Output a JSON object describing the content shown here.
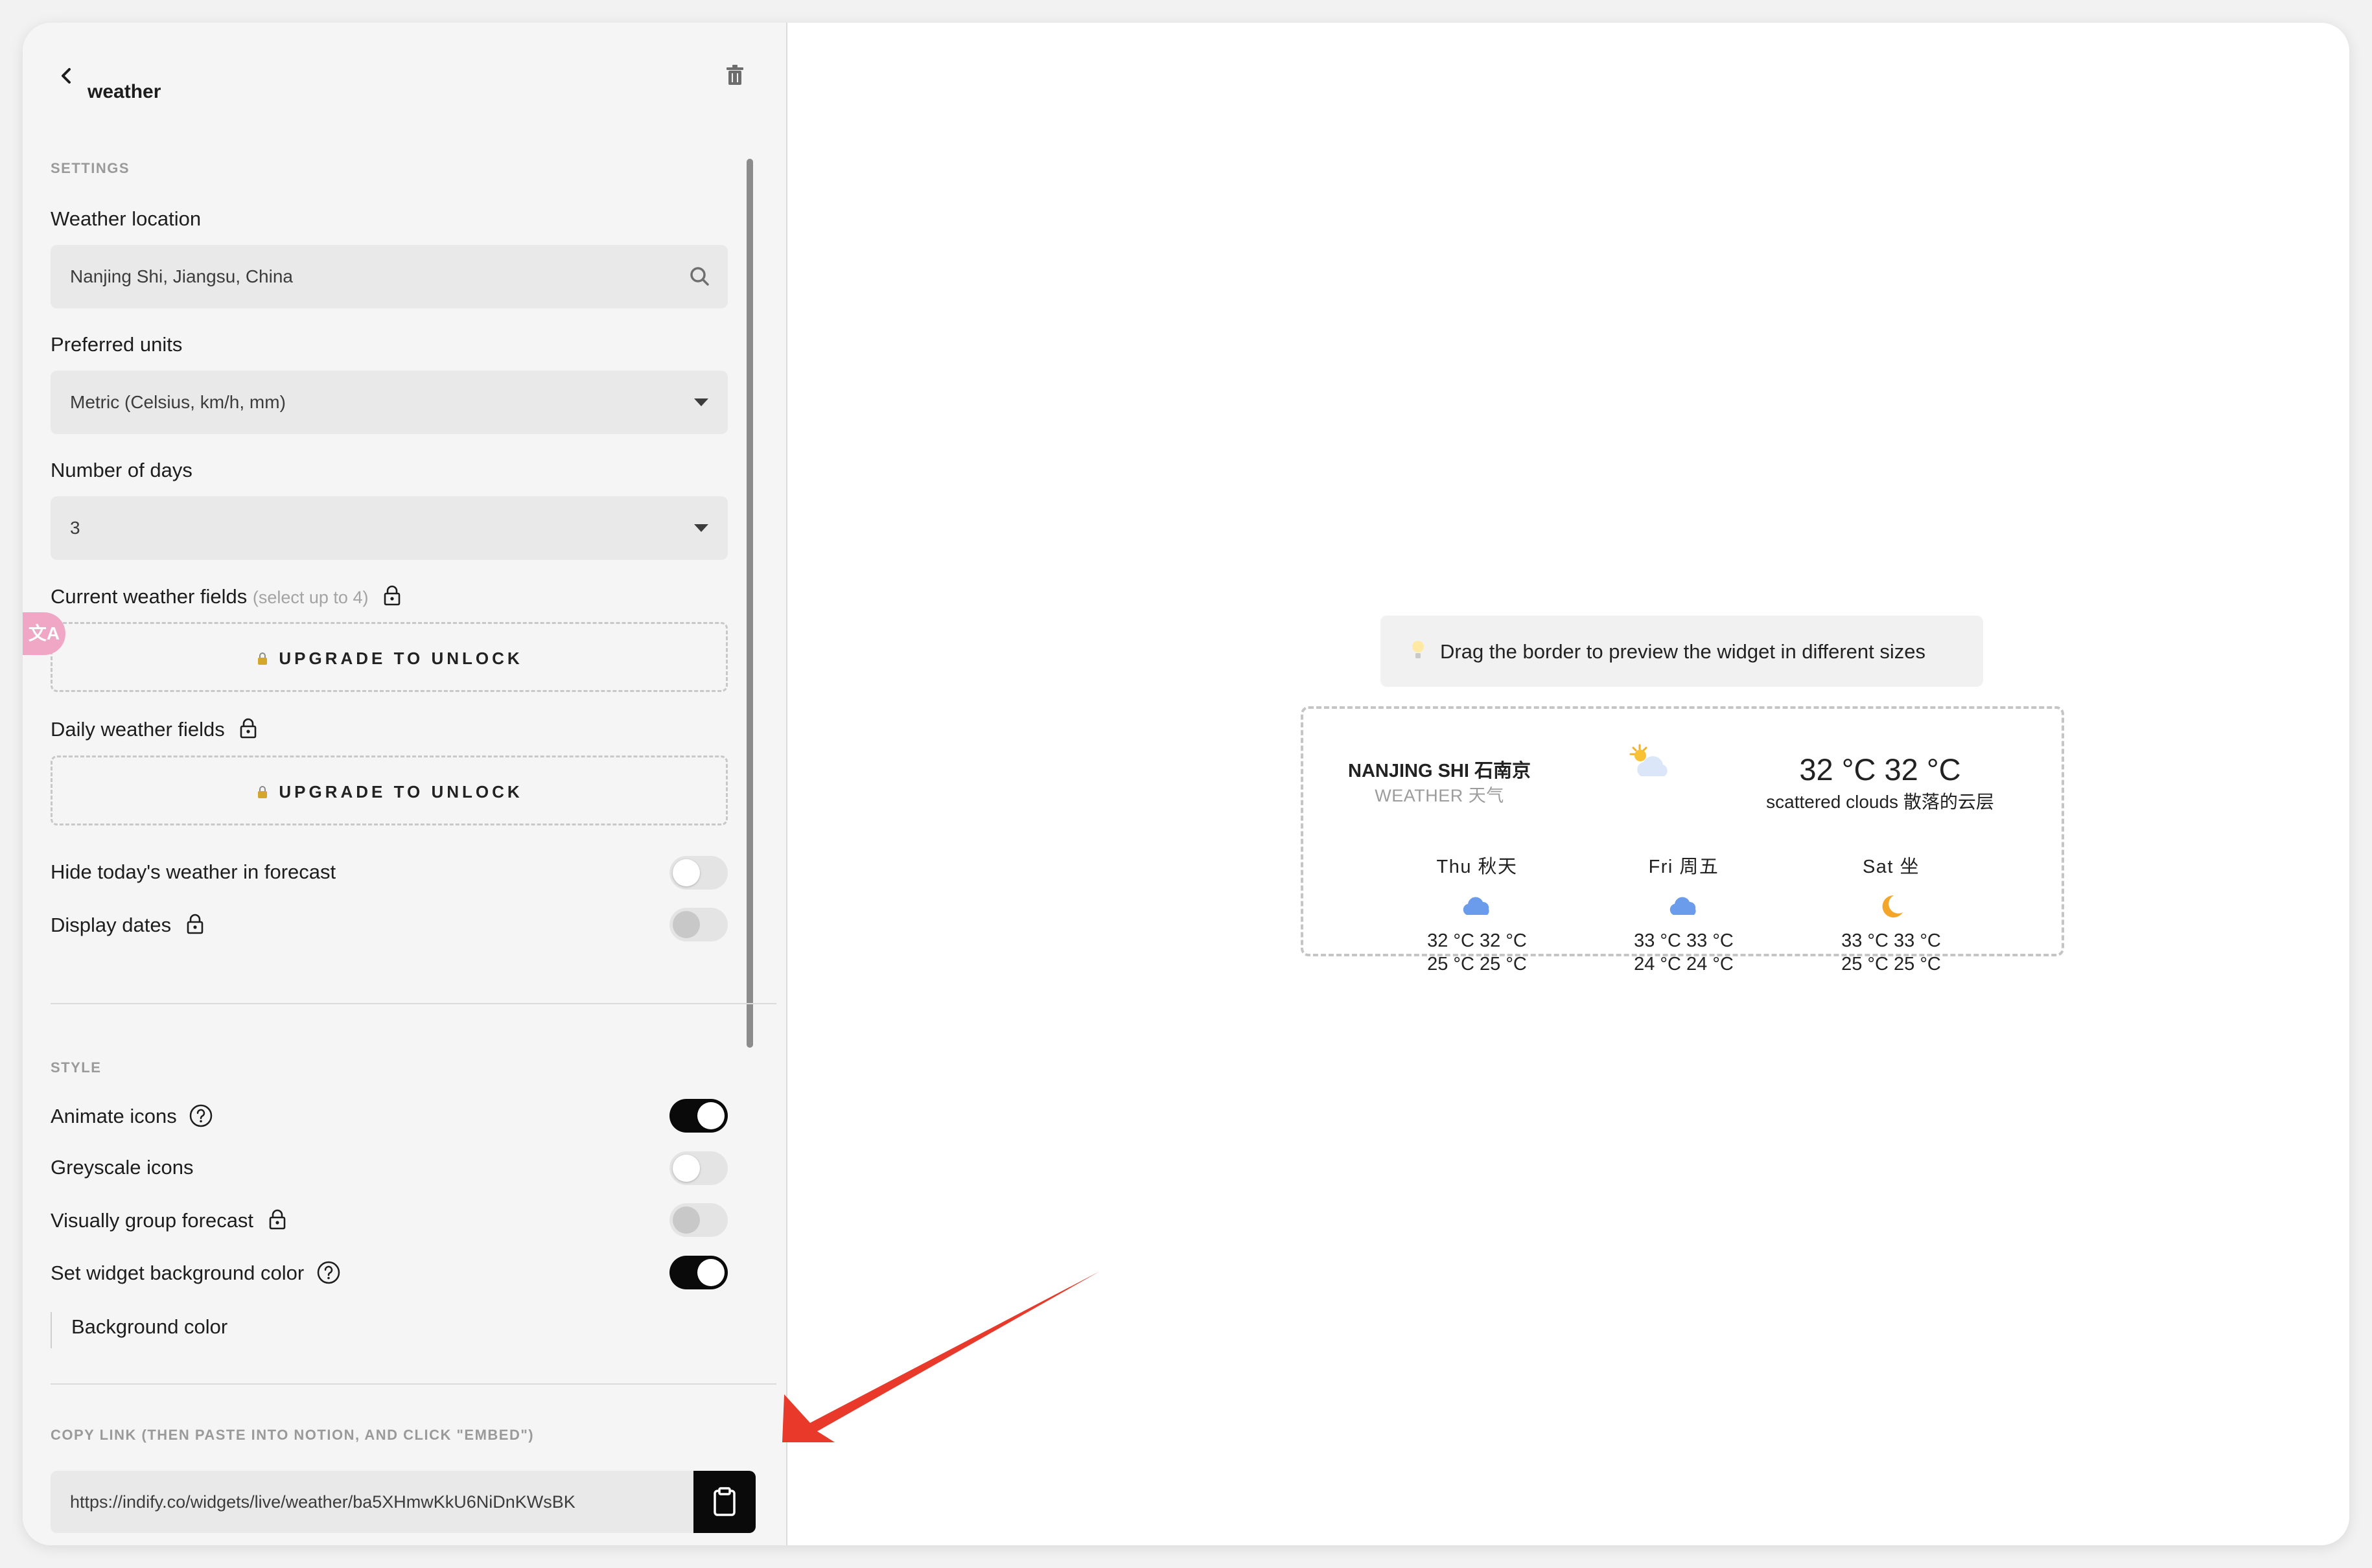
{
  "header": {
    "title": "weather"
  },
  "settings": {
    "section_label": "SETTINGS",
    "location": {
      "label": "Weather location",
      "value": "Nanjing Shi, Jiangsu, China"
    },
    "units": {
      "label": "Preferred units",
      "value": "Metric (Celsius, km/h, mm)"
    },
    "days": {
      "label": "Number of days",
      "value": "3"
    },
    "current_fields": {
      "label": "Current weather fields",
      "hint": "(select up to 4)",
      "button": "UPGRADE TO UNLOCK"
    },
    "daily_fields": {
      "label": "Daily weather fields",
      "button": "UPGRADE TO UNLOCK"
    },
    "hide_today": {
      "label": "Hide today's weather in forecast",
      "state": "off"
    },
    "display_dates": {
      "label": "Display dates",
      "state": "disabled"
    }
  },
  "translate_badge": "文A",
  "style": {
    "section_label": "STYLE",
    "animate_icons": {
      "label": "Animate icons",
      "state": "on"
    },
    "greyscale_icons": {
      "label": "Greyscale icons",
      "state": "off"
    },
    "group_forecast": {
      "label": "Visually group forecast",
      "state": "disabled"
    },
    "widget_bg": {
      "label": "Set widget background color",
      "state": "on"
    },
    "bg_color": {
      "label": "Background color"
    }
  },
  "copy_link": {
    "section_label": "COPY LINK (THEN PASTE INTO NOTION, AND CLICK \"EMBED\")",
    "url": "https://indify.co/widgets/live/weather/ba5XHmwKkU6NiDnKWsBK"
  },
  "preview": {
    "hint": "Drag the border to preview the widget in different sizes",
    "widget": {
      "location": "NANJING SHI 石南京",
      "sublabel": "WEATHER 天气",
      "current_temp": "32 °C 32 °C",
      "current_desc": "scattered clouds 散落的云层",
      "current_icon": "sun-cloud-icon",
      "days": [
        {
          "name": "Thu 秋天",
          "icon": "cloud-icon",
          "high": "32 °C 32 °C",
          "low": "25 °C 25 °C"
        },
        {
          "name": "Fri 周五",
          "icon": "cloud-icon",
          "high": "33 °C 33 °C",
          "low": "24 °C 24 °C"
        },
        {
          "name": "Sat 坐",
          "icon": "moon-icon",
          "high": "33 °C 33 °C",
          "low": "25 °C 25 °C"
        }
      ]
    }
  },
  "colors": {
    "accent": "#0a0a0a",
    "arrow": "#e8392a",
    "cloud": "#6b9cec",
    "moon": "#f4a62a"
  }
}
